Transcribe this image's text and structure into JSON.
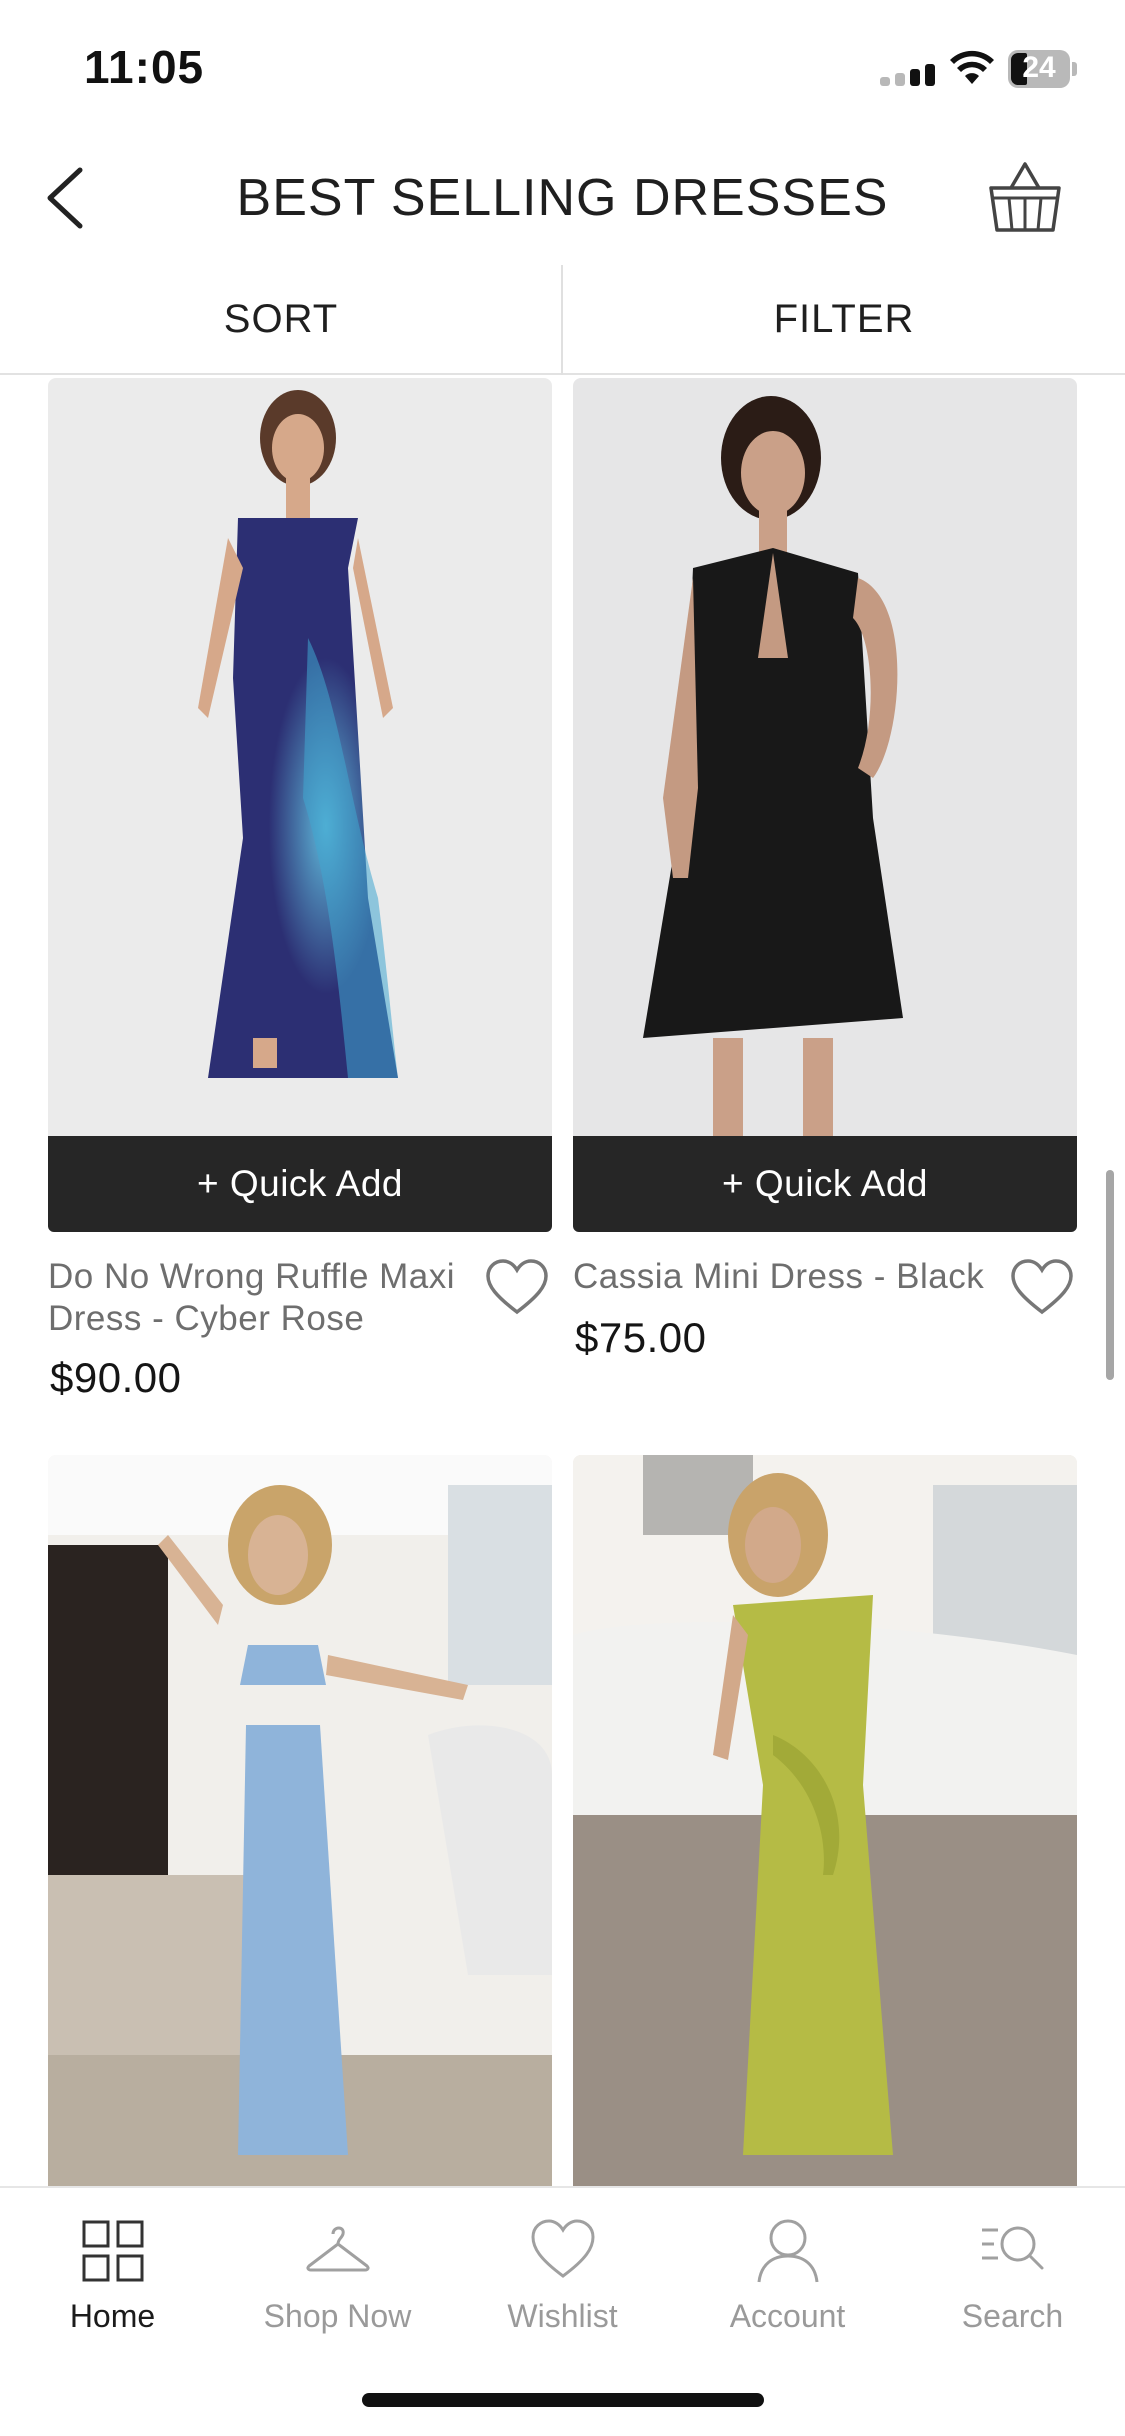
{
  "status_bar": {
    "time": "11:05",
    "battery": "24"
  },
  "header": {
    "title": "BEST SELLING DRESSES"
  },
  "toolbar": {
    "sort_label": "SORT",
    "filter_label": "FILTER"
  },
  "products": [
    {
      "name_line1": "Do No Wrong Ruffle Maxi",
      "name_line2": "Dress - Cyber Rose",
      "price": "$90.00",
      "quick_add": "+ Quick Add"
    },
    {
      "name_line1": "Cassia Mini Dress - Black",
      "name_line2": "",
      "price": "$75.00",
      "quick_add": "+ Quick Add"
    },
    {
      "name_line1": "",
      "name_line2": "",
      "price": "",
      "quick_add": ""
    },
    {
      "name_line1": "",
      "name_line2": "",
      "price": "",
      "quick_add": ""
    }
  ],
  "tabbar": {
    "items": [
      {
        "label": "Home",
        "icon": "grid-icon",
        "active": true
      },
      {
        "label": "Shop Now",
        "icon": "hanger-icon",
        "active": false
      },
      {
        "label": "Wishlist",
        "icon": "heart-icon",
        "active": false
      },
      {
        "label": "Account",
        "icon": "person-icon",
        "active": false
      },
      {
        "label": "Search",
        "icon": "search-icon",
        "active": false
      }
    ]
  },
  "colors": {
    "quick_add_bg": "#262626",
    "active_tab": "#1b1b1b",
    "inactive_tab": "#9a9a9a"
  }
}
